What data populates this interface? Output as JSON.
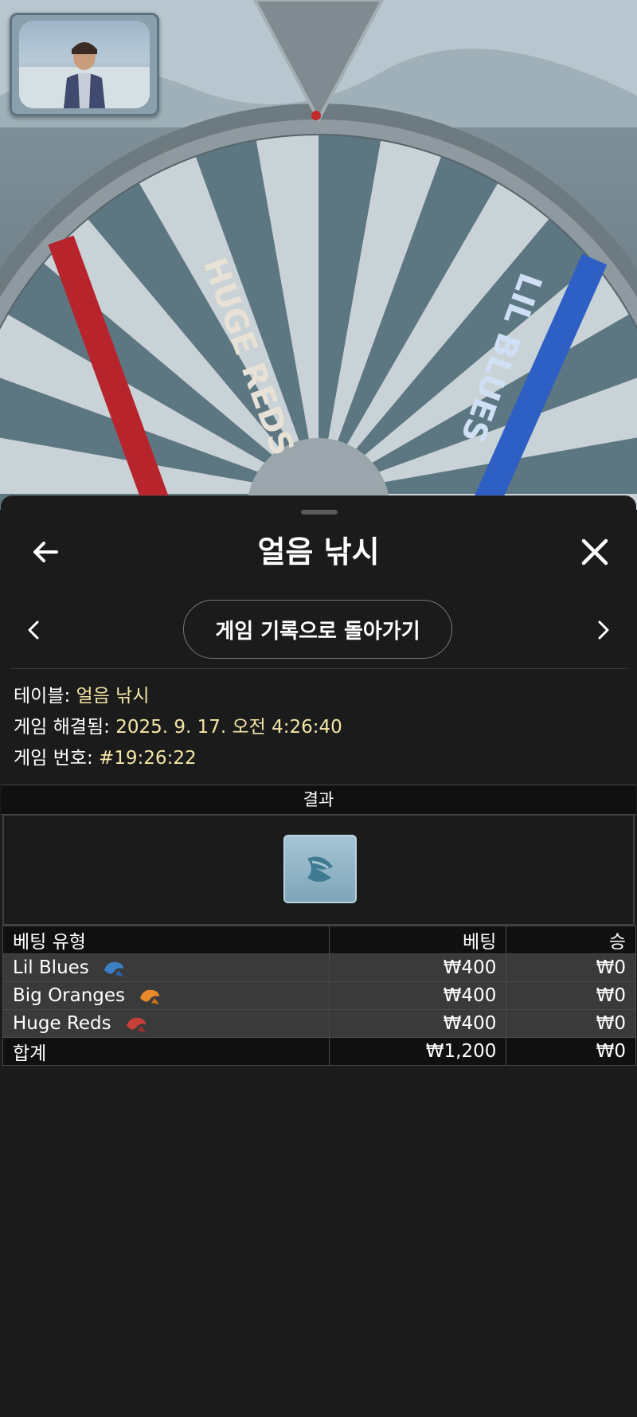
{
  "background": {
    "wheel_labels": [
      "HUGE REDS",
      "LIL BLUES"
    ]
  },
  "sheet": {
    "title": "얼음 낚시",
    "back_to_history_label": "게임 기록으로 돌아가기"
  },
  "info": {
    "table_label": "테이블:",
    "table_value": "얼음 낚시",
    "resolved_label": "게임 해결됨:",
    "resolved_value": "2025. 9. 17. 오전 4:26:40",
    "game_id_label": "게임 번호:",
    "game_id_value": "#19:26:22"
  },
  "result": {
    "header": "결과",
    "tile_icon": "leaf-icon",
    "tile_color": "#8fb4c8"
  },
  "bets": {
    "headers": [
      "베팅 유형",
      "베팅",
      "승"
    ],
    "rows": [
      {
        "type": "Lil Blues",
        "bet": "₩400",
        "win": "₩0",
        "icon": "blue-fish-icon",
        "color": "#3b7fc4"
      },
      {
        "type": "Big Oranges",
        "bet": "₩400",
        "win": "₩0",
        "icon": "orange-fish-icon",
        "color": "#e88a2a"
      },
      {
        "type": "Huge Reds",
        "bet": "₩400",
        "win": "₩0",
        "icon": "red-fish-icon",
        "color": "#c6413a"
      }
    ],
    "total": {
      "type": "합계",
      "bet": "₩1,200",
      "win": "₩0"
    }
  }
}
